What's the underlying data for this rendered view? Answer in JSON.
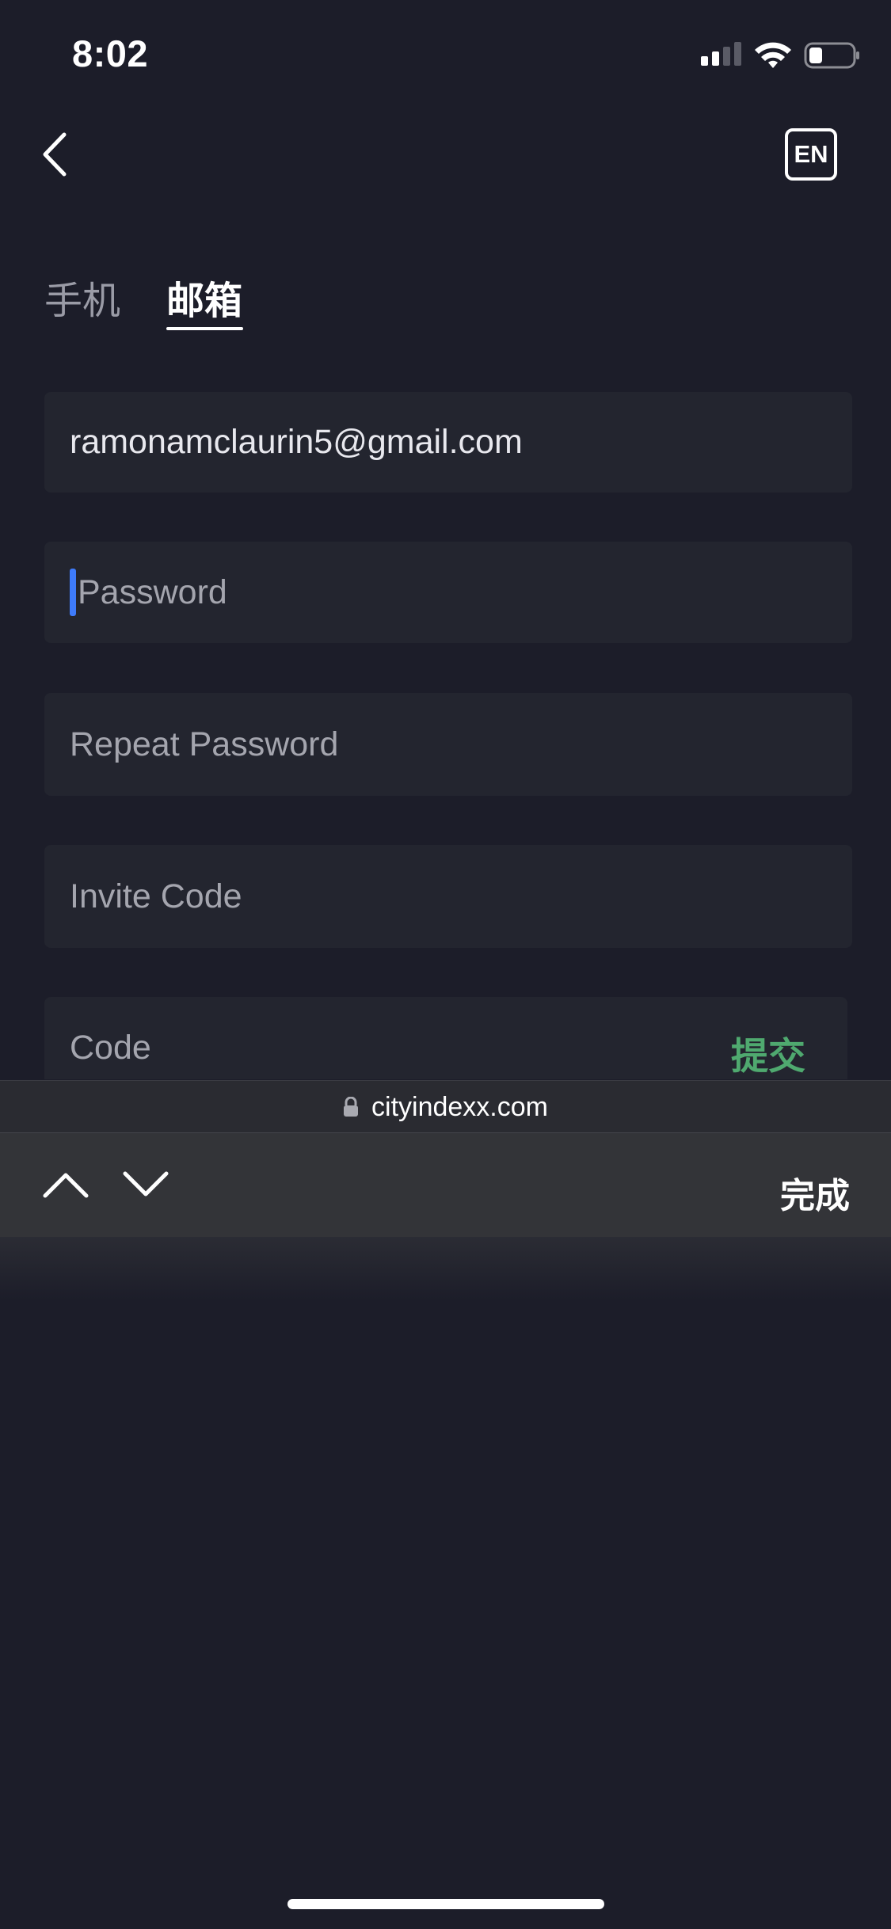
{
  "status_bar": {
    "time": "8:02",
    "icons": [
      "signal-icon",
      "wifi-icon",
      "battery-icon"
    ]
  },
  "top_bar": {
    "back_icon": "chevron-left-icon",
    "language_label": "EN"
  },
  "tabs": [
    {
      "label": "手机",
      "active": false
    },
    {
      "label": "邮箱",
      "active": true
    }
  ],
  "form": {
    "email_value": "ramonamclaurin5@gmail.com",
    "password_placeholder": "Password",
    "repeat_password_placeholder": "Repeat Password",
    "invite_code_placeholder": "Invite Code",
    "code_placeholder": "Code",
    "submit_label": "提交"
  },
  "browser": {
    "url": "cityindexx.com",
    "lock_icon": "lock-icon"
  },
  "keyboard_toolbar": {
    "prev_icon": "chevron-up-icon",
    "next_icon": "chevron-down-icon",
    "done_label": "完成"
  },
  "colors": {
    "background": "#1c1d29",
    "field_background": "#23252f",
    "accent_green": "#4fa96f",
    "caret_blue": "#3e7bfa"
  }
}
